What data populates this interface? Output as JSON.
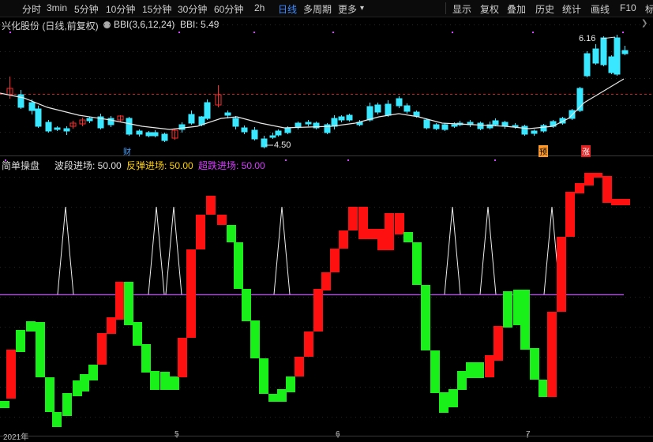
{
  "toolbar": {
    "periods": [
      "分时",
      "3min",
      "5分钟",
      "10分钟",
      "15分钟",
      "30分钟",
      "60分钟",
      "2h",
      "日线",
      "多周期",
      "更多"
    ],
    "more_arrow": "▾",
    "active": "日线",
    "right_items": [
      "显示",
      "复权",
      "叠加",
      "历史",
      "统计",
      "画线",
      "F10",
      "标"
    ]
  },
  "header": {
    "stock": "兴化股份 (日线,前复权)",
    "indicator": "BBI(3,6,12,24)",
    "bbi_value": "BBI: 5.49",
    "collapse": "❯"
  },
  "main_chart": {
    "high_label": "6.16",
    "low_label": "4.50",
    "markers": [
      "财",
      "预",
      "涨"
    ]
  },
  "sub_header": {
    "name": "简单操盘",
    "a": "波段进场: 50.00",
    "b": "反弹进场: 50.00",
    "c": "超跌进场: 50.00"
  },
  "xaxis": {
    "labels": [
      "2021年",
      "5",
      "6",
      "7"
    ]
  },
  "colors": {
    "up": "#ff2a2a",
    "down": "#39e7ff",
    "green": "#19f019",
    "red": "#ff1010",
    "purple": "#c84cff",
    "yellow": "#ffd000",
    "bbi": "#e8e8e8",
    "active": "#3d8bff"
  },
  "chart_data": {
    "type": "candlestick",
    "indicator": "BBI(3,6,12,24)",
    "high": 6.16,
    "low": 4.5,
    "bbi_last": 5.49,
    "levels": [
      50,
      50,
      50
    ],
    "series": [
      "波段进场",
      "反弹进场",
      "超跌进场"
    ]
  }
}
